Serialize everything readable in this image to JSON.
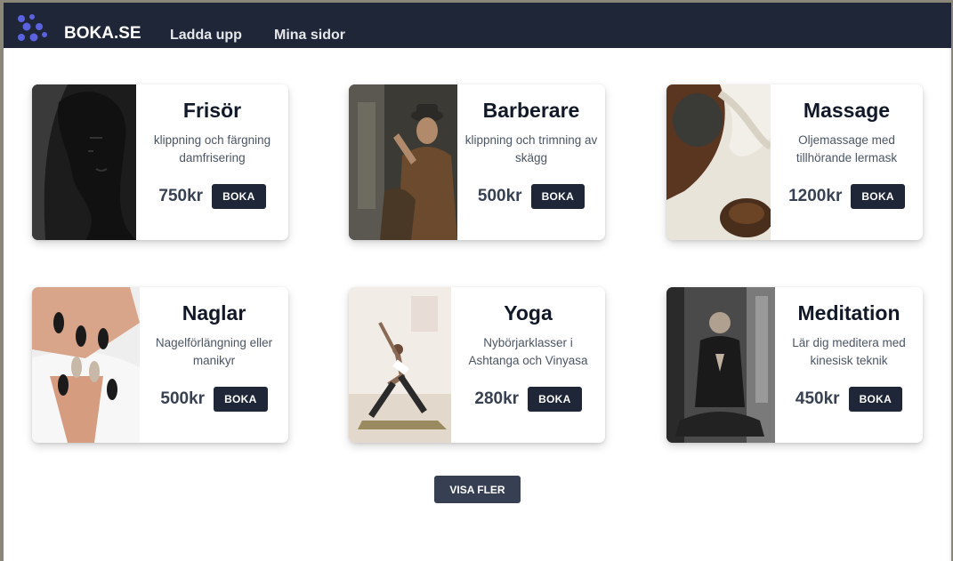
{
  "header": {
    "brand": "BOKA.SE",
    "nav": [
      "Ladda upp",
      "Mina sidor"
    ],
    "logo_icon": "dots-logo-icon"
  },
  "colors": {
    "navbar": "#1e2637",
    "button": "#1e2637",
    "more_button": "#373f52",
    "logo": "#5b62e0"
  },
  "services": [
    {
      "title": "Frisör",
      "desc": "klippning och färgning damfrisering",
      "price": "750kr",
      "button": "BOKA"
    },
    {
      "title": "Barberare",
      "desc": "klippning och trimning av skägg",
      "price": "500kr",
      "button": "BOKA"
    },
    {
      "title": "Massage",
      "desc": "Oljemassage med tillhörande lermask",
      "price": "1200kr",
      "button": "BOKA"
    },
    {
      "title": "Naglar",
      "desc": "Nagelförlängning eller manikyr",
      "price": "500kr",
      "button": "BOKA"
    },
    {
      "title": "Yoga",
      "desc": "Nybörjarklasser i Ashtanga och Vinyasa",
      "price": "280kr",
      "button": "BOKA"
    },
    {
      "title": "Meditation",
      "desc": "Lär dig meditera med kinesisk teknik",
      "price": "450kr",
      "button": "BOKA"
    }
  ],
  "more_button": "VISA FLER"
}
